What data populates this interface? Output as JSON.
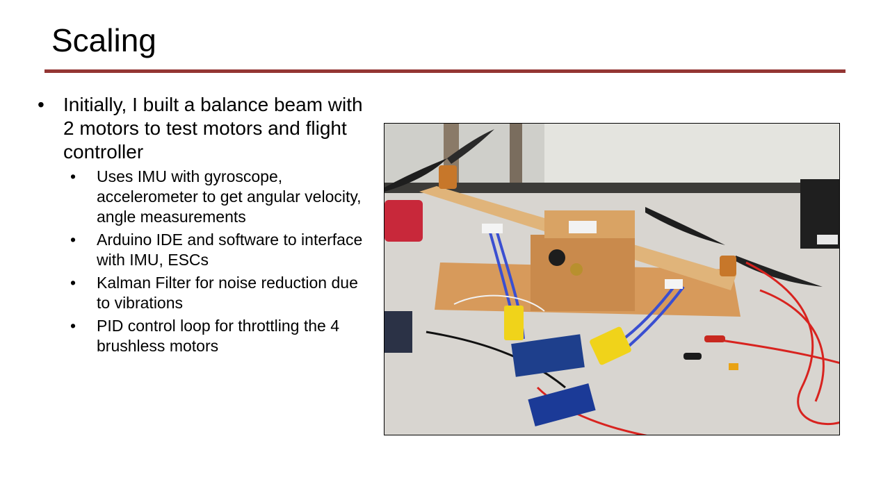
{
  "slide": {
    "title": "Scaling",
    "accent_color": "#943634",
    "bullets": [
      {
        "text": "Initially, I built a balance beam with 2 motors to test motors and flight controller",
        "children": [
          "Uses IMU with gyroscope, accelerometer to get angular velocity, angle measurements",
          "Arduino IDE and software to interface with IMU, ESCs",
          "Kalman Filter for noise reduction due to vibrations",
          "PID control loop for throttling the 4 brushless motors"
        ]
      }
    ],
    "photo": {
      "label": "balance-beam-test-rig-photo"
    }
  }
}
